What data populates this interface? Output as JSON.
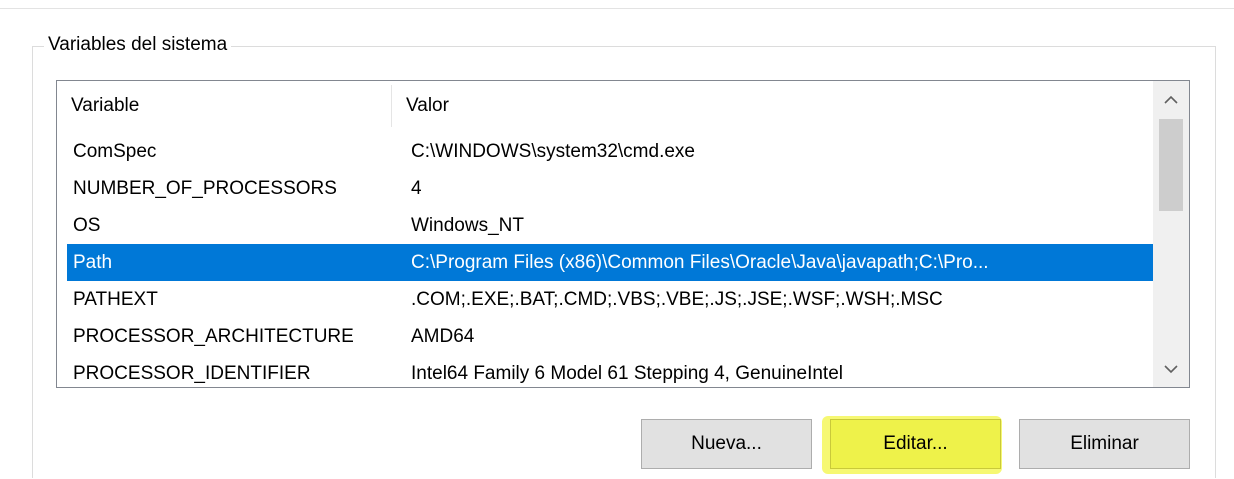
{
  "group": {
    "title": "Variables del sistema"
  },
  "list": {
    "headers": {
      "variable": "Variable",
      "value": "Valor"
    },
    "rows": [
      {
        "name": "ComSpec",
        "value": "C:\\WINDOWS\\system32\\cmd.exe"
      },
      {
        "name": "NUMBER_OF_PROCESSORS",
        "value": "4"
      },
      {
        "name": "OS",
        "value": "Windows_NT"
      },
      {
        "name": "Path",
        "value": "C:\\Program Files (x86)\\Common Files\\Oracle\\Java\\javapath;C:\\Pro..."
      },
      {
        "name": "PATHEXT",
        "value": ".COM;.EXE;.BAT;.CMD;.VBS;.VBE;.JS;.JSE;.WSF;.WSH;.MSC"
      },
      {
        "name": "PROCESSOR_ARCHITECTURE",
        "value": "AMD64"
      },
      {
        "name": "PROCESSOR_IDENTIFIER",
        "value": "Intel64 Family 6 Model 61 Stepping 4, GenuineIntel"
      }
    ],
    "selected_row": "Path",
    "selected_color": "#0078d7"
  },
  "scrollbar": {
    "up_icon": "chevron-up-icon",
    "down_icon": "chevron-down-icon"
  },
  "buttons": {
    "new_label": "Nueva...",
    "edit_label": "Editar...",
    "delete_label": "Eliminar"
  },
  "highlight_color": "#eef24a"
}
